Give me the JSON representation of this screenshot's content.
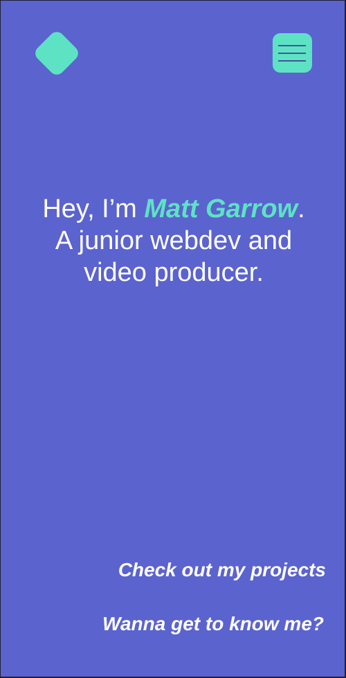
{
  "header": {
    "logo_icon": "diamond-logo-icon",
    "menu_icon": "hamburger-menu-icon"
  },
  "hero": {
    "greeting_prefix": "Hey, I’m ",
    "name": "Matt Garrow",
    "greeting_suffix": ".",
    "line2": "A junior webdev and",
    "line3": "video producer."
  },
  "links": {
    "projects": "Check out my projects",
    "about": "Wanna get to know me?"
  },
  "colors": {
    "background": "#5b63cf",
    "accent": "#5de3c3",
    "text": "#ffffff"
  }
}
